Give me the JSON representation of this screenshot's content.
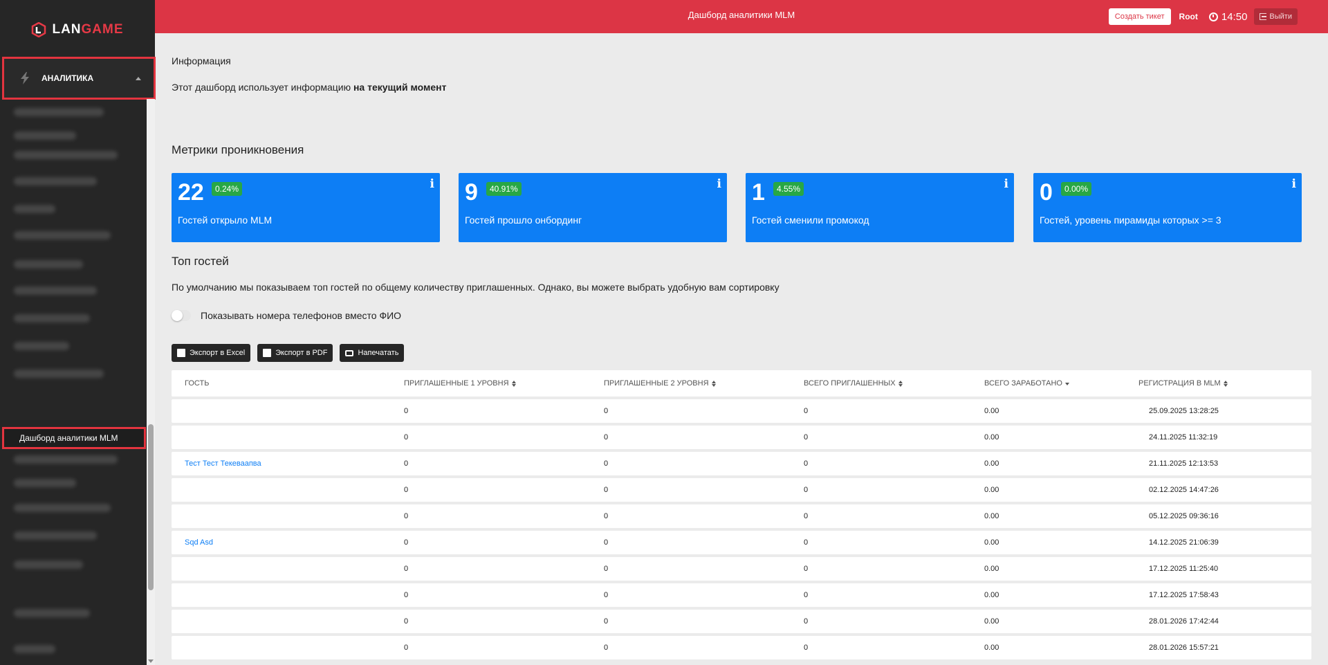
{
  "brand": {
    "logo_prefix": "LAN",
    "logo_suffix": "GAME"
  },
  "sidebar": {
    "section_label": "АНАЛИТИКА",
    "active_item_label": "Дашборд аналитики MLM"
  },
  "header": {
    "title": "Дашборд аналитики MLM",
    "create_ticket_label": "Создать тикет",
    "user": "Root",
    "time": "14:50",
    "logout_label": "Выйти"
  },
  "info": {
    "title": "Информация",
    "text_prefix": "Этот дашборд использует информацию ",
    "text_bold": "на текущий момент"
  },
  "metrics": {
    "title": "Метрики проникновения",
    "cards": [
      {
        "value": "22",
        "percent": "0.24%",
        "label": "Гостей открыло MLM"
      },
      {
        "value": "9",
        "percent": "40.91%",
        "label": "Гостей прошло онбординг"
      },
      {
        "value": "1",
        "percent": "4.55%",
        "label": "Гостей сменили промокод"
      },
      {
        "value": "0",
        "percent": "0.00%",
        "label": "Гостей, уровень пирамиды которых >= 3"
      }
    ]
  },
  "top_guests": {
    "title": "Топ гостей",
    "description": "По умолчанию мы показываем топ гостей по общему количеству приглашенных. Однако, вы можете выбрать удобную вам сортировку",
    "toggle_label": "Показывать номера телефонов вместо ФИО",
    "export_excel": "Экспорт в Excel",
    "export_pdf": "Экспорт в PDF",
    "print": "Напечатать"
  },
  "table": {
    "columns": [
      "ГОСТЬ",
      "ПРИГЛАШЕННЫЕ 1 УРОВНЯ",
      "ПРИГЛАШЕННЫЕ 2 УРОВНЯ",
      "ВСЕГО ПРИГЛАШЕННЫХ",
      "ВСЕГО ЗАРАБОТАНО",
      "РЕГИСТРАЦИЯ В MLM"
    ],
    "rows": [
      {
        "guest": "",
        "lvl1": "0",
        "lvl2": "0",
        "total": "0",
        "earned": "0.00",
        "registered": "25.09.2025 13:28:25"
      },
      {
        "guest": "",
        "lvl1": "0",
        "lvl2": "0",
        "total": "0",
        "earned": "0.00",
        "registered": "24.11.2025 11:32:19"
      },
      {
        "guest": "Тест Тест Текеваапва",
        "lvl1": "0",
        "lvl2": "0",
        "total": "0",
        "earned": "0.00",
        "registered": "21.11.2025 12:13:53"
      },
      {
        "guest": "",
        "lvl1": "0",
        "lvl2": "0",
        "total": "0",
        "earned": "0.00",
        "registered": "02.12.2025 14:47:26"
      },
      {
        "guest": "",
        "lvl1": "0",
        "lvl2": "0",
        "total": "0",
        "earned": "0.00",
        "registered": "05.12.2025 09:36:16"
      },
      {
        "guest": "Sqd Asd",
        "lvl1": "0",
        "lvl2": "0",
        "total": "0",
        "earned": "0.00",
        "registered": "14.12.2025 21:06:39"
      },
      {
        "guest": "",
        "lvl1": "0",
        "lvl2": "0",
        "total": "0",
        "earned": "0.00",
        "registered": "17.12.2025 11:25:40"
      },
      {
        "guest": "",
        "lvl1": "0",
        "lvl2": "0",
        "total": "0",
        "earned": "0.00",
        "registered": "17.12.2025 17:58:43"
      },
      {
        "guest": "",
        "lvl1": "0",
        "lvl2": "0",
        "total": "0",
        "earned": "0.00",
        "registered": "28.01.2026 17:42:44"
      },
      {
        "guest": "",
        "lvl1": "0",
        "lvl2": "0",
        "total": "0",
        "earned": "0.00",
        "registered": "28.01.2026 15:57:21"
      }
    ]
  },
  "colors": {
    "header_red": "#dc3545",
    "card_blue": "#0d7ef5",
    "badge_green": "#28a745",
    "sidebar_dark": "#262626"
  }
}
